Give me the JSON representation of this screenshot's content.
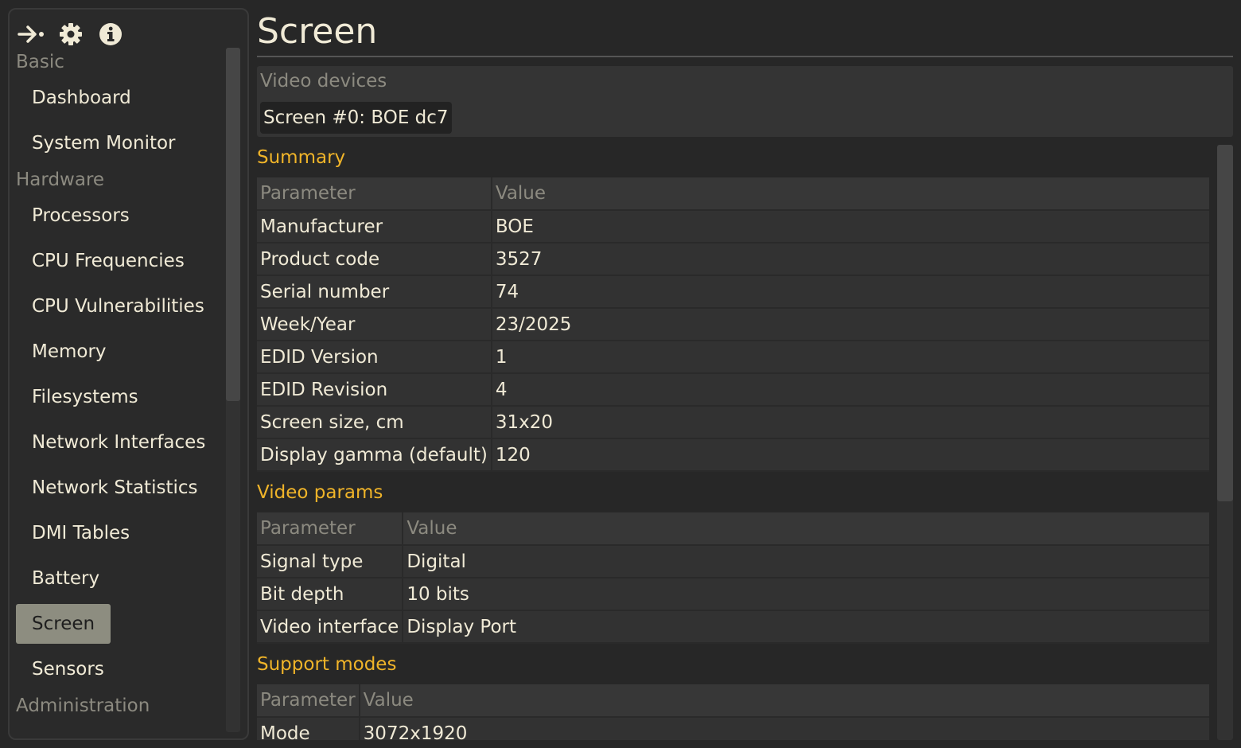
{
  "toolbar": {
    "icons": [
      "back-arrow-icon",
      "gear-icon",
      "info-icon"
    ]
  },
  "sidebar": {
    "sections": [
      {
        "title": "Basic",
        "items": [
          "Dashboard",
          "System Monitor"
        ]
      },
      {
        "title": "Hardware",
        "items": [
          "Processors",
          "CPU Frequencies",
          "CPU Vulnerabilities",
          "Memory",
          "Filesystems",
          "Network Interfaces",
          "Network Statistics",
          "DMI Tables",
          "Battery",
          "Screen",
          "Sensors"
        ]
      },
      {
        "title": "Administration",
        "items": []
      }
    ],
    "active_item": "Screen"
  },
  "page": {
    "title": "Screen",
    "devices_label": "Video devices",
    "device": "Screen #0: BOE dc7"
  },
  "summary": {
    "title": "Summary",
    "header": [
      "Parameter",
      "Value"
    ],
    "rows": [
      [
        "Manufacturer",
        "BOE"
      ],
      [
        "Product code",
        "3527"
      ],
      [
        "Serial number",
        "74"
      ],
      [
        "Week/Year",
        "23/2025"
      ],
      [
        "EDID Version",
        "1"
      ],
      [
        "EDID Revision",
        "4"
      ],
      [
        "Screen size, cm",
        "31x20"
      ],
      [
        "Display gamma (default)",
        "120"
      ]
    ]
  },
  "video_params": {
    "title": "Video params",
    "header": [
      "Parameter",
      "Value"
    ],
    "rows": [
      [
        "Signal type",
        "Digital"
      ],
      [
        "Bit depth",
        "10 bits"
      ],
      [
        "Video interface",
        "Display Port"
      ]
    ]
  },
  "support_modes": {
    "title": "Support modes",
    "header": [
      "Parameter",
      "Value"
    ],
    "rows": [
      [
        "Mode",
        "3072x1920"
      ]
    ]
  },
  "colors": {
    "accent": "#f0b429",
    "active_bg": "#8d8d80",
    "text": "#f0ead6",
    "muted": "#8c8a80"
  }
}
